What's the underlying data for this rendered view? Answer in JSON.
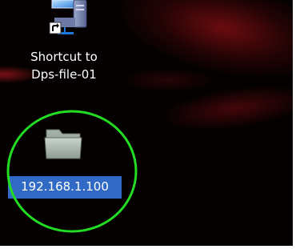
{
  "desktop": {
    "icons": [
      {
        "id": "shortcut",
        "label": "Shortcut to Dps-file-01",
        "icon": "network-computer-shortcut-icon",
        "selected": false
      },
      {
        "id": "folder",
        "label": "192.168.1.100",
        "icon": "folder-icon",
        "selected": true
      }
    ]
  },
  "annotation": {
    "shape": "circle",
    "color": "#22dd22"
  }
}
